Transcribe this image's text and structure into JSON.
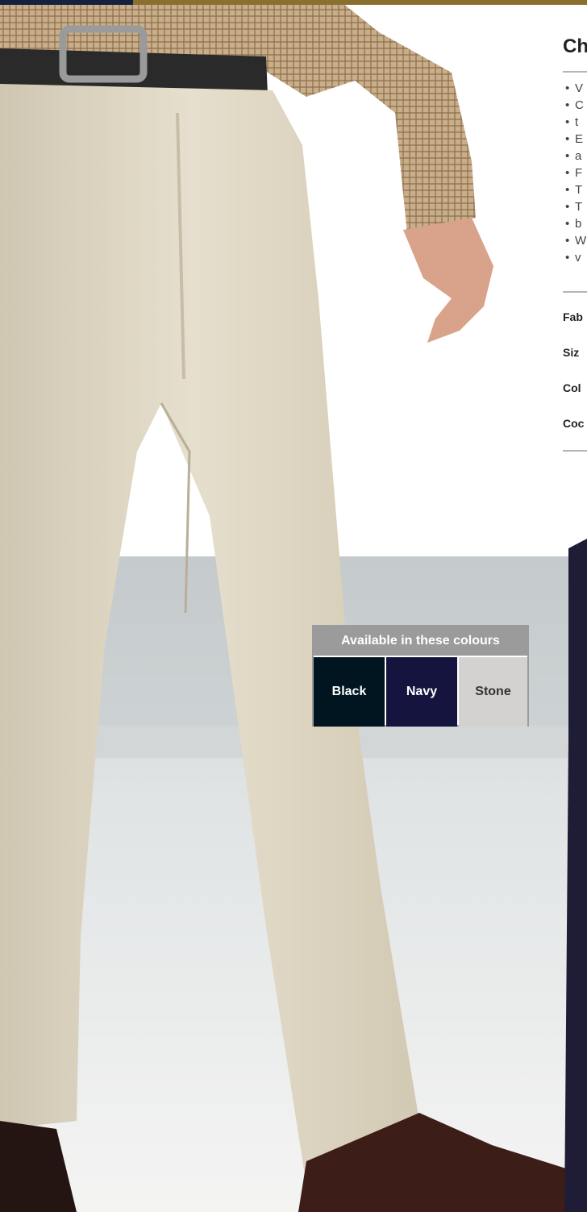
{
  "heading": {
    "title": "Ch"
  },
  "features": [
    "V",
    "C",
    "t",
    "E",
    "a",
    "F",
    "T",
    "T",
    "b",
    "W",
    "v"
  ],
  "specs": {
    "fabric": "Fab",
    "sizes": "Siz",
    "colours": "Col",
    "code": "Coc"
  },
  "colour_box": {
    "header": "Available in these colours",
    "swatches": [
      {
        "label": "Black",
        "color": "#001520",
        "text_color": "#ffffff"
      },
      {
        "label": "Navy",
        "color": "#14143f",
        "text_color": "#ffffff"
      },
      {
        "label": "Stone",
        "color": "#d4d2d0",
        "text_color": "#333333"
      }
    ]
  },
  "colors": {
    "accent_gold": "#8b6f2e",
    "accent_navy": "#14223d",
    "trousers": "#ddd6c4",
    "shirt": "#b49a7a"
  }
}
